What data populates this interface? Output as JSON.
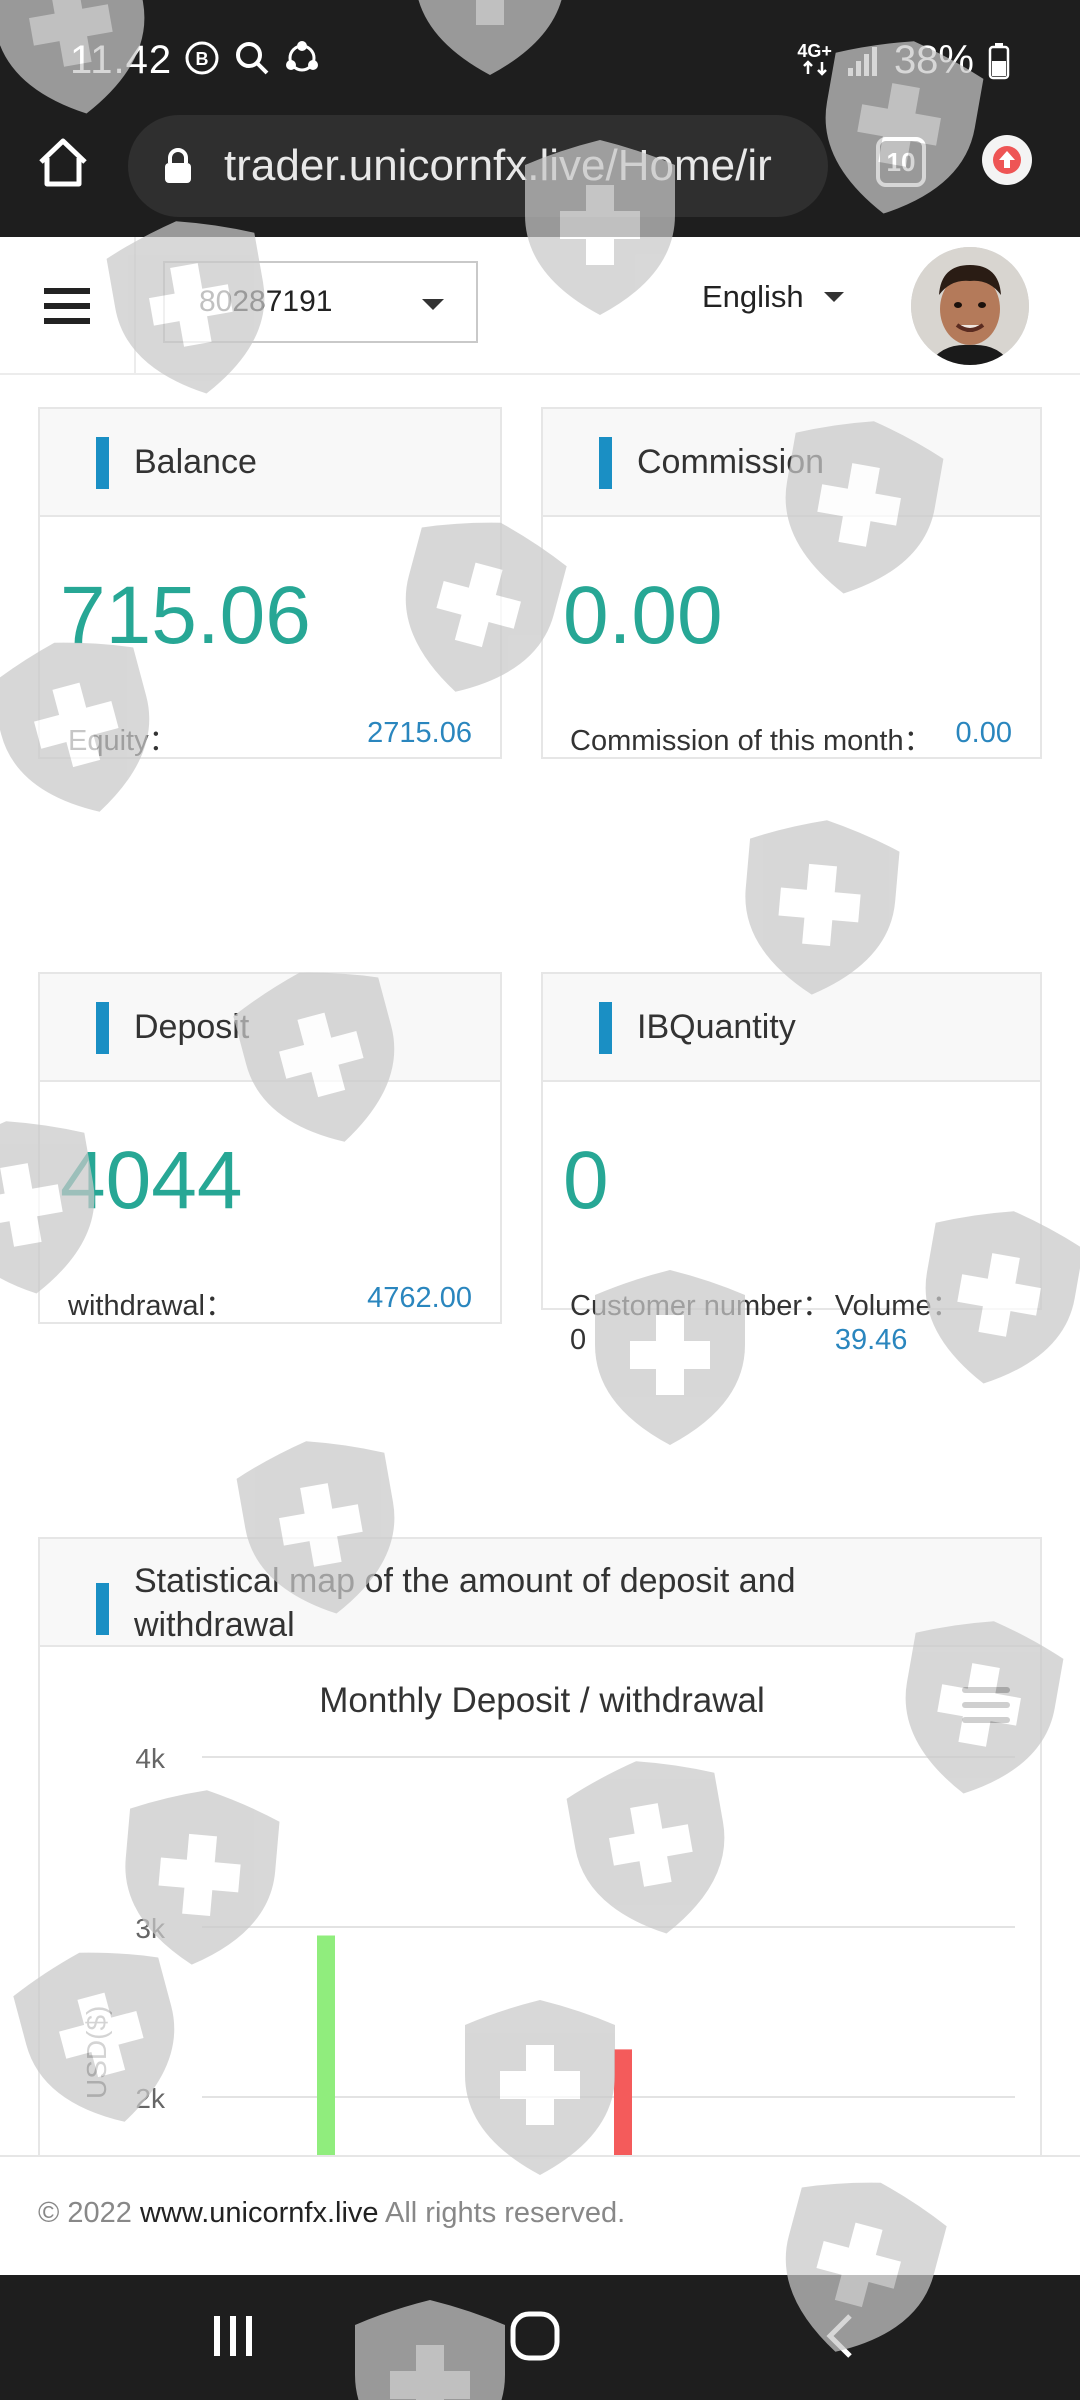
{
  "status_bar": {
    "time": "11.42",
    "network": "4G+",
    "battery": "38%"
  },
  "browser": {
    "url": "trader.unicornfx.live/Home/ir",
    "tab_count": "10"
  },
  "header": {
    "account": "80287191",
    "language": "English"
  },
  "cards": {
    "balance": {
      "title": "Balance",
      "value": "715.06",
      "footer_label": "Equity：",
      "footer_value": "2715.06"
    },
    "commission": {
      "title": "Commission",
      "value": "0.00",
      "footer_label": "Commission of this month：",
      "footer_value": "0.00"
    },
    "deposit": {
      "title": "Deposit",
      "value": "4044",
      "footer_label": "withdrawal：",
      "footer_value": "4762.00"
    },
    "ibquantity": {
      "title": "IBQuantity",
      "value": "0",
      "footer_label": "Customer number：0",
      "footer_label2": "Volume：",
      "footer_value": "39.46"
    }
  },
  "chart_section": {
    "title_line1": "Statistical map of the amount of deposit and",
    "title_line2": "withdrawal"
  },
  "chart_data": {
    "type": "bar",
    "title": "Monthly Deposit / withdrawal",
    "ylabel": "USD($)",
    "yticks": [
      "4k",
      "3k",
      "2k"
    ],
    "ylim": [
      1650,
      4000
    ],
    "series": [
      {
        "values": [
          2950
        ],
        "color": "#90ed7d"
      },
      {
        "values": [
          2280
        ],
        "color": "#f45b5b"
      }
    ]
  },
  "footer": {
    "copyright": "© 2022",
    "site": "www.unicornfx.live",
    "rights": "All rights reserved."
  }
}
